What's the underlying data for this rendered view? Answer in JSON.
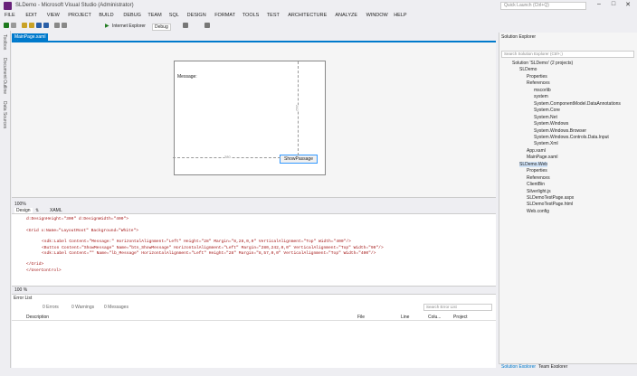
{
  "window": {
    "title": "SLDemo - Microsoft Visual Studio (Administrator)",
    "quick_launch": "Quick Launch (Ctrl+Q)"
  },
  "menu": [
    "FILE",
    "EDIT",
    "VIEW",
    "PROJECT",
    "BUILD",
    "DEBUG",
    "TEAM",
    "SQL",
    "DESIGN",
    "FORMAT",
    "TOOLS",
    "TEST",
    "ARCHITECTURE",
    "ANALYZE",
    "WINDOW",
    "HELP"
  ],
  "toolbar": {
    "run_target": "Internet Explorer",
    "config": "Debug"
  },
  "left_tabs": [
    "Toolbox",
    "Document Outline",
    "Data Sources"
  ],
  "doc_tab": "MainPage.xaml",
  "designer": {
    "label": "Message:",
    "button": "ShowPassage",
    "width_dim": "280",
    "height_dim": "242"
  },
  "split": {
    "zoom": "100%",
    "design_tab": "Design",
    "xaml_tab": "XAML"
  },
  "code_lines": [
    "d:DesignHeight=\"300\" d:DesignWidth=\"400\">",
    "",
    "<Grid x:Name=\"LayoutRoot\" Background=\"White\">",
    "",
    "    <sdk:Label Content=\"Message:\" HorizontalAlignment=\"Left\" Height=\"28\" Margin=\"8,28,0,0\" VerticalAlignment=\"Top\" Width=\"400\"/>",
    "    <Button Content=\"ShowMessage\" Name=\"btn_ShowMessage\" HorizontalAlignment=\"Left\" Margin=\"280,242,0,0\" VerticalAlignment=\"Top\" Width=\"90\"/>",
    "    <sdk:Label Content=\"\" Name=\"lb_Message\" HorizontalAlignment=\"Left\" Height=\"28\" Margin=\"8,57,0,0\" VerticalAlignment=\"Top\" Width=\"400\"/>",
    "",
    "</Grid>",
    "</UserControl>"
  ],
  "zoom_bottom": "100 %",
  "errors": {
    "title": "Error List",
    "errors": "0 Errors",
    "warnings": "0 Warnings",
    "messages": "0 Messages",
    "search": "Search Error List",
    "cols": [
      "Description",
      "File",
      "Line",
      "Colu...",
      "Project"
    ]
  },
  "solution_explorer": {
    "title": "Solution Explorer",
    "search": "Search Solution Explorer (Ctrl+;)",
    "items": [
      {
        "t": "Solution 'SLDemo' (2 projects)",
        "d": 0
      },
      {
        "t": "SLDemo",
        "d": 1
      },
      {
        "t": "Properties",
        "d": 2
      },
      {
        "t": "References",
        "d": 2
      },
      {
        "t": "mscorlib",
        "d": 3
      },
      {
        "t": "system",
        "d": 3
      },
      {
        "t": "System.ComponentModel.DataAnnotations",
        "d": 3
      },
      {
        "t": "System.Core",
        "d": 3
      },
      {
        "t": "System.Net",
        "d": 3
      },
      {
        "t": "System.Windows",
        "d": 3
      },
      {
        "t": "System.Windows.Browser",
        "d": 3
      },
      {
        "t": "System.Windows.Controls.Data.Input",
        "d": 3
      },
      {
        "t": "System.Xml",
        "d": 3
      },
      {
        "t": "App.xaml",
        "d": 2
      },
      {
        "t": "MainPage.xaml",
        "d": 2
      },
      {
        "t": "SLDemo.Web",
        "d": 1
      },
      {
        "t": "Properties",
        "d": 2
      },
      {
        "t": "References",
        "d": 2
      },
      {
        "t": "ClientBin",
        "d": 2
      },
      {
        "t": "Silverlight.js",
        "d": 2
      },
      {
        "t": "SLDemoTestPage.aspx",
        "d": 2
      },
      {
        "t": "SLDemoTestPage.html",
        "d": 2
      },
      {
        "t": "Web.config",
        "d": 2
      }
    ],
    "tabs": [
      "Solution Explorer",
      "Team Explorer"
    ]
  }
}
